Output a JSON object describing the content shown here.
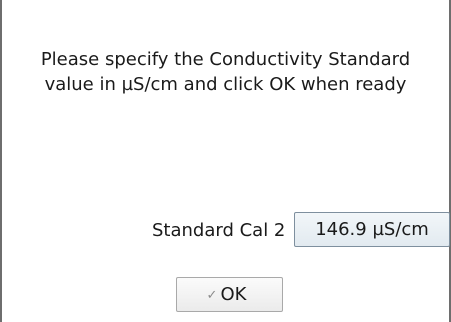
{
  "dialog": {
    "prompt_line1": "Please specify the Conductivity Standard",
    "prompt_line2": "value in µS/cm and click OK when ready",
    "field_label": "Standard Cal 2",
    "field_value": "146.9 µS/cm",
    "ok_label": "OK",
    "ok_icon": "check-icon"
  }
}
